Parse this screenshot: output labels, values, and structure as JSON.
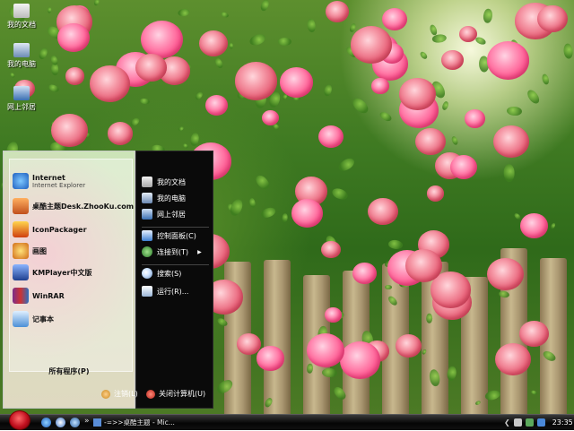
{
  "desktop": {
    "icons": [
      {
        "label": "我的文档"
      },
      {
        "label": "我的电脑"
      },
      {
        "label": "网上邻居"
      }
    ]
  },
  "start_menu": {
    "pinned": [
      {
        "title": "Internet",
        "subtitle": "Internet Explorer"
      },
      {
        "title": "桌酷主题Desk.ZhooKu.com",
        "subtitle": ""
      },
      {
        "title": "IconPackager",
        "subtitle": ""
      },
      {
        "title": "画图",
        "subtitle": ""
      },
      {
        "title": "KMPlayer中文版",
        "subtitle": ""
      },
      {
        "title": "WinRAR",
        "subtitle": ""
      },
      {
        "title": "记事本",
        "subtitle": ""
      }
    ],
    "all_programs": "所有程序(P)",
    "places": [
      {
        "label": "我的文档"
      },
      {
        "label": "我的电脑"
      },
      {
        "label": "网上邻居"
      },
      {
        "label": "控制面板(C)"
      },
      {
        "label": "连接到(T)"
      },
      {
        "label": "搜索(S)"
      },
      {
        "label": "运行(R)..."
      }
    ],
    "logoff": "注销(L)",
    "shutdown": "关闭计算机(U)"
  },
  "taskbar": {
    "overflow": "»",
    "task_label": "-=>>桌酷主题 - Mic...",
    "clock": "23:35"
  },
  "colors": {
    "taskbar_bg": "#0a0a0a",
    "start_menu_right_bg": "#0a0a0a",
    "rose_accent": "#e8637a"
  }
}
